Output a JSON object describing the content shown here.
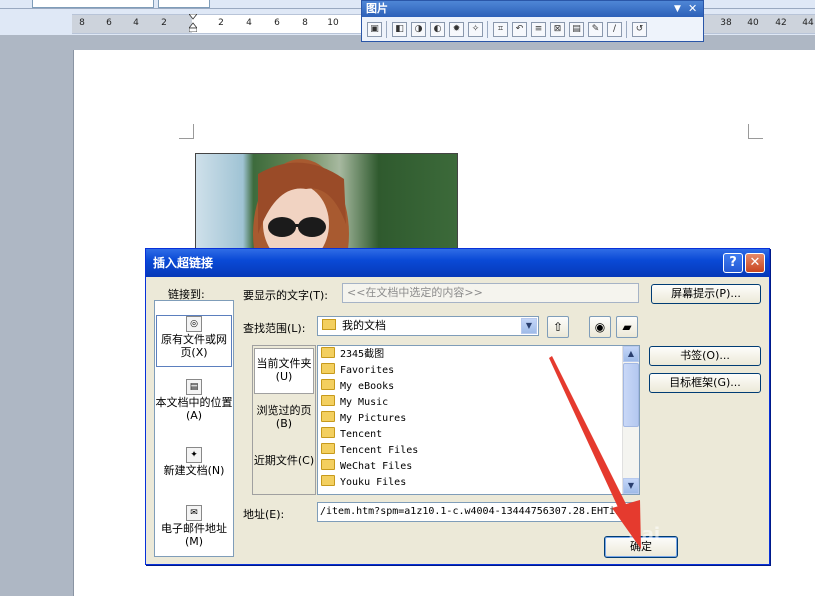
{
  "picture_toolbar": {
    "title": "图片",
    "menu_glyph": "▼",
    "close_glyph": "✕",
    "icons": [
      "insert-picture-icon",
      "color-icon",
      "more-contrast-icon",
      "less-contrast-icon",
      "more-brightness-icon",
      "less-brightness-icon",
      "crop-icon",
      "rotate-icon",
      "line-style-icon",
      "compress-icon",
      "text-wrapping-icon",
      "format-picture-icon",
      "set-transparent-icon",
      "reset-picture-icon"
    ]
  },
  "ruler": {
    "labels": [
      "8",
      "6",
      "4",
      "2",
      "2",
      "4",
      "6",
      "8",
      "10",
      "38",
      "40",
      "42",
      "44"
    ]
  },
  "dialog": {
    "title": "插入超链接",
    "help_glyph": "?",
    "close_glyph": "✕",
    "link_to_label": "链接到:",
    "link_to_items": [
      {
        "label": "原有文件或网页(X)"
      },
      {
        "label": "本文档中的位置(A)"
      },
      {
        "label": "新建文档(N)"
      },
      {
        "label": "电子邮件地址(M)"
      }
    ],
    "text_to_display_label": "要显示的文字(T):",
    "text_to_display_value": "<<在文档中选定的内容>>",
    "screentip_button": "屏幕提示(P)...",
    "look_in_label": "查找范围(L):",
    "look_in_value": "我的文档",
    "bookmark_button": "书签(O)...",
    "target_frame_button": "目标框架(G)...",
    "subnav": [
      {
        "label": "当前文件夹(U)"
      },
      {
        "label": "浏览过的页(B)"
      },
      {
        "label": "近期文件(C)"
      }
    ],
    "files": [
      "2345截图",
      "Favorites",
      "My eBooks",
      "My Music",
      "My Pictures",
      "Tencent",
      "Tencent Files",
      "WeChat Files",
      "Youku Files"
    ],
    "address_label": "地址(E):",
    "address_value": "/item.htm?spm=a1z10.1-c.w4004-13444756307.28.EHTiIY",
    "ok_button": "确定"
  },
  "colors": {
    "dialog_title_bar": "#0a4ad6",
    "annotation_arrow": "#e53a2e",
    "dialog_face": "#ece9d8"
  }
}
